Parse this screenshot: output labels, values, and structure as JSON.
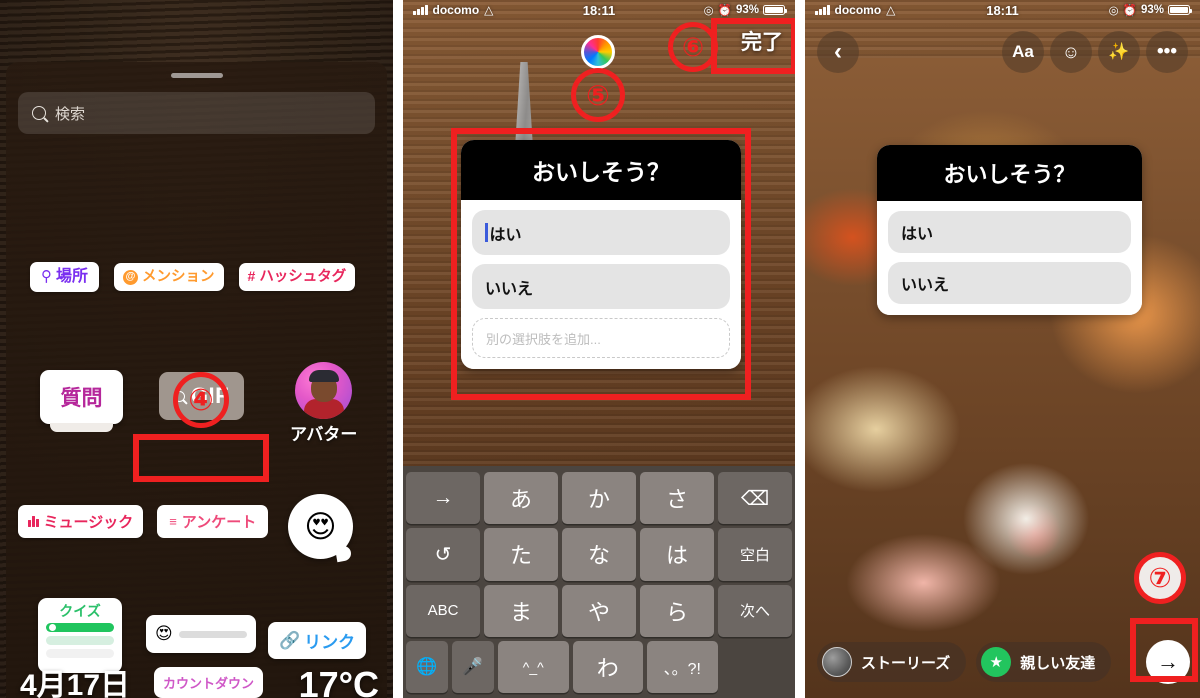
{
  "panels": {
    "p1": {
      "name": "Instagram story sticker tray",
      "search": {
        "placeholder": "検索",
        "icon": "search-icon"
      },
      "chips": [
        {
          "label": "場所",
          "icon": "location-pin-icon"
        },
        {
          "label": "メンション",
          "icon": "at-sign-icon"
        },
        {
          "label": "ハッシュタグ",
          "icon": "hash-icon"
        }
      ],
      "question_sticker": "質問",
      "gif_sticker": "GIF",
      "avatar_label": "アバター",
      "music_sticker": "ミュージック",
      "poll_sticker": "アンケート",
      "emoji_slider": "😍",
      "quiz_sticker": "クイズ",
      "link_sticker": "リンク",
      "date_sticker": "4月17日",
      "countdown_sticker": "カウントダウン",
      "temperature_sticker": "17°C",
      "marker": "④"
    },
    "p2": {
      "status": {
        "carrier": "docomo",
        "time": "18:11",
        "battery": "93%",
        "wifi": "wifi-icon",
        "signal": "signal-bars-icon"
      },
      "done_label": "完了",
      "marker_color": "⑤",
      "marker_done": "⑥",
      "poll": {
        "question": "おいしそう？",
        "options": [
          "はい",
          "いいえ"
        ],
        "add_placeholder": "別の選択肢を追加..."
      },
      "keyboard": {
        "rows": [
          [
            "→",
            "あ",
            "か",
            "さ",
            "⌫"
          ],
          [
            "↺",
            "た",
            "な",
            "は",
            "空白"
          ],
          [
            "ABC",
            "ま",
            "や",
            "ら",
            "次へ"
          ],
          [
            "🌐",
            "🎤",
            "^_^",
            "わ",
            "、。?!"
          ]
        ]
      }
    },
    "p3": {
      "status": {
        "carrier": "docomo",
        "time": "18:11",
        "battery": "93%"
      },
      "top_icons": [
        "back-chevron-icon",
        "Aa",
        "sticker-smiley-icon",
        "sparkles-icon",
        "more-dots-icon"
      ],
      "poll": {
        "question": "おいしそう？",
        "options": [
          "はい",
          "いいえ"
        ]
      },
      "bottom": {
        "stories_label": "ストーリーズ",
        "close_friends_label": "親しい友達",
        "send_icon": "arrow-right-icon"
      },
      "marker": "⑦"
    }
  },
  "colors": {
    "annotation_red": "#ef2020",
    "poll_header_bg": "#000000",
    "place_purple": "#7a2ff0",
    "mention_orange": "#ff9a2e",
    "hashtag_pink": "#e8265c",
    "link_blue": "#2a9bf0",
    "quiz_green": "#20c55e",
    "close_friends_green": "#22c55e"
  }
}
